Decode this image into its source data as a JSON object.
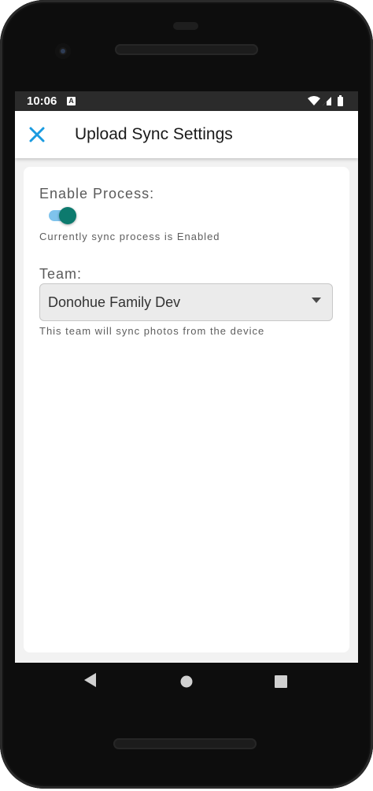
{
  "status_bar": {
    "time": "10:06",
    "notification_icon": "A"
  },
  "app_bar": {
    "close_icon": "close-x",
    "title": "Upload Sync Settings"
  },
  "form": {
    "enable_process": {
      "label": "Enable Process:",
      "enabled": true,
      "helper": "Currently sync process is Enabled"
    },
    "team": {
      "label": "Team:",
      "selected": "Donohue Family Dev",
      "helper": "This team will sync photos from the device"
    }
  },
  "colors": {
    "accent": "#1a9be0",
    "toggle_thumb": "#0d7a6e",
    "toggle_track": "#7fc3ec"
  },
  "nav": {
    "back_icon": "triangle-back",
    "home_icon": "circle-home",
    "recents_icon": "square-recents"
  }
}
